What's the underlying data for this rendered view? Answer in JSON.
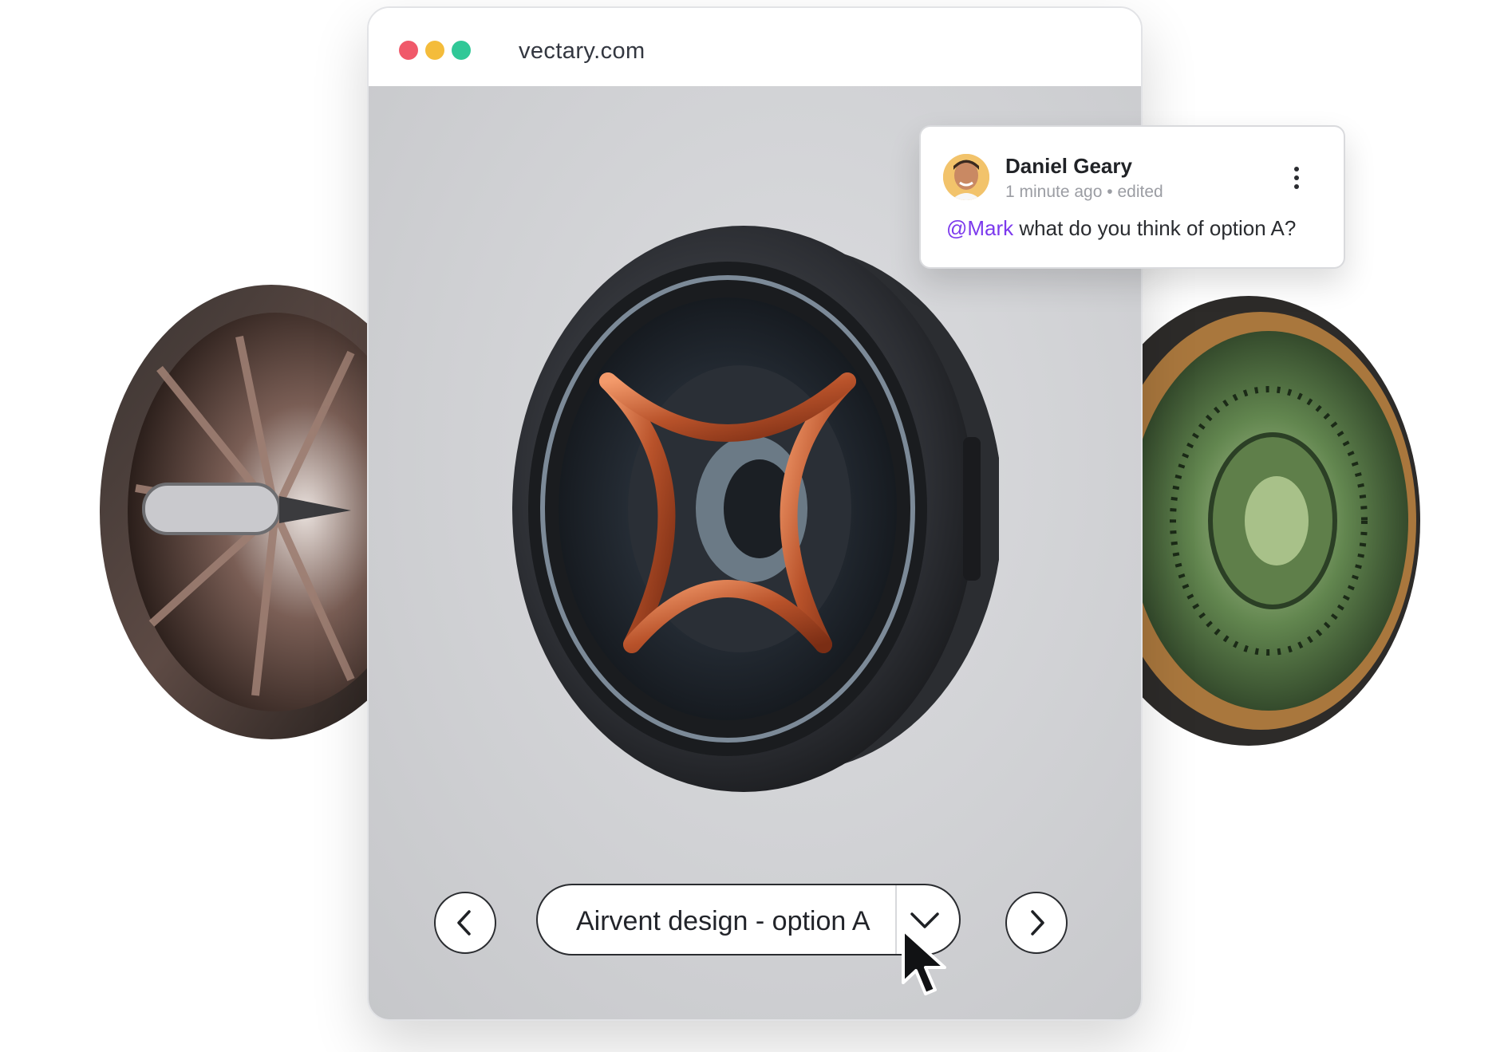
{
  "browser": {
    "url": "vectary.com",
    "traffic_lights": {
      "close": "#f0596a",
      "minimize": "#f4bc3b",
      "zoom": "#30c897"
    }
  },
  "viewer": {
    "selected_design": "Airvent design - option A"
  },
  "comment": {
    "author": "Daniel Geary",
    "time": "1 minute ago",
    "separator": "•",
    "status": "edited",
    "mention": "@Mark",
    "message": " what do you think of option A?",
    "accent_color": "#7c3aed"
  },
  "icons": {
    "prev": "chevron-left-icon",
    "next": "chevron-right-icon",
    "dropdown": "chevron-down-icon",
    "more": "more-vertical-icon",
    "cursor": "mouse-pointer-icon"
  }
}
